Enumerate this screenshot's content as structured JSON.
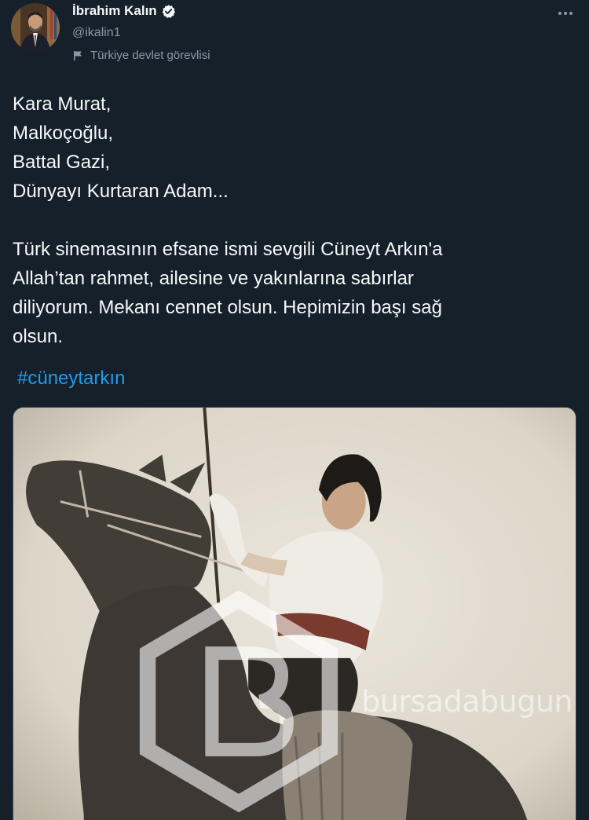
{
  "author": {
    "display_name": "İbrahim Kalın",
    "handle": "@ikalin1",
    "label": "Türkiye devlet görevlisi"
  },
  "tweet": {
    "lines": [
      "Kara Murat,",
      "Malkoçoğlu,",
      "Battal Gazi,",
      "Dünyayı Kurtaran Adam..."
    ],
    "paragraph_lines": [
      "Türk sinemasının efsane ismi sevgili Cüneyt Arkın'a",
      "Allah’tan rahmet, ailesine ve yakınlarına sabırlar",
      "diliyorum. Mekanı cennet olsun. Hepimizin başı sağ",
      "olsun."
    ],
    "hashtag": "#cüneytarkın"
  },
  "watermark": {
    "text": "bursadabugun"
  },
  "colors": {
    "background": "#15202b",
    "text": "#f7f9f9",
    "secondary": "#8b98a5",
    "link": "#1d9bf0",
    "verified": "#1d9bf0"
  },
  "icons": {
    "verified": "verified-badge-icon",
    "label": "flag-icon",
    "more": "more-icon"
  }
}
